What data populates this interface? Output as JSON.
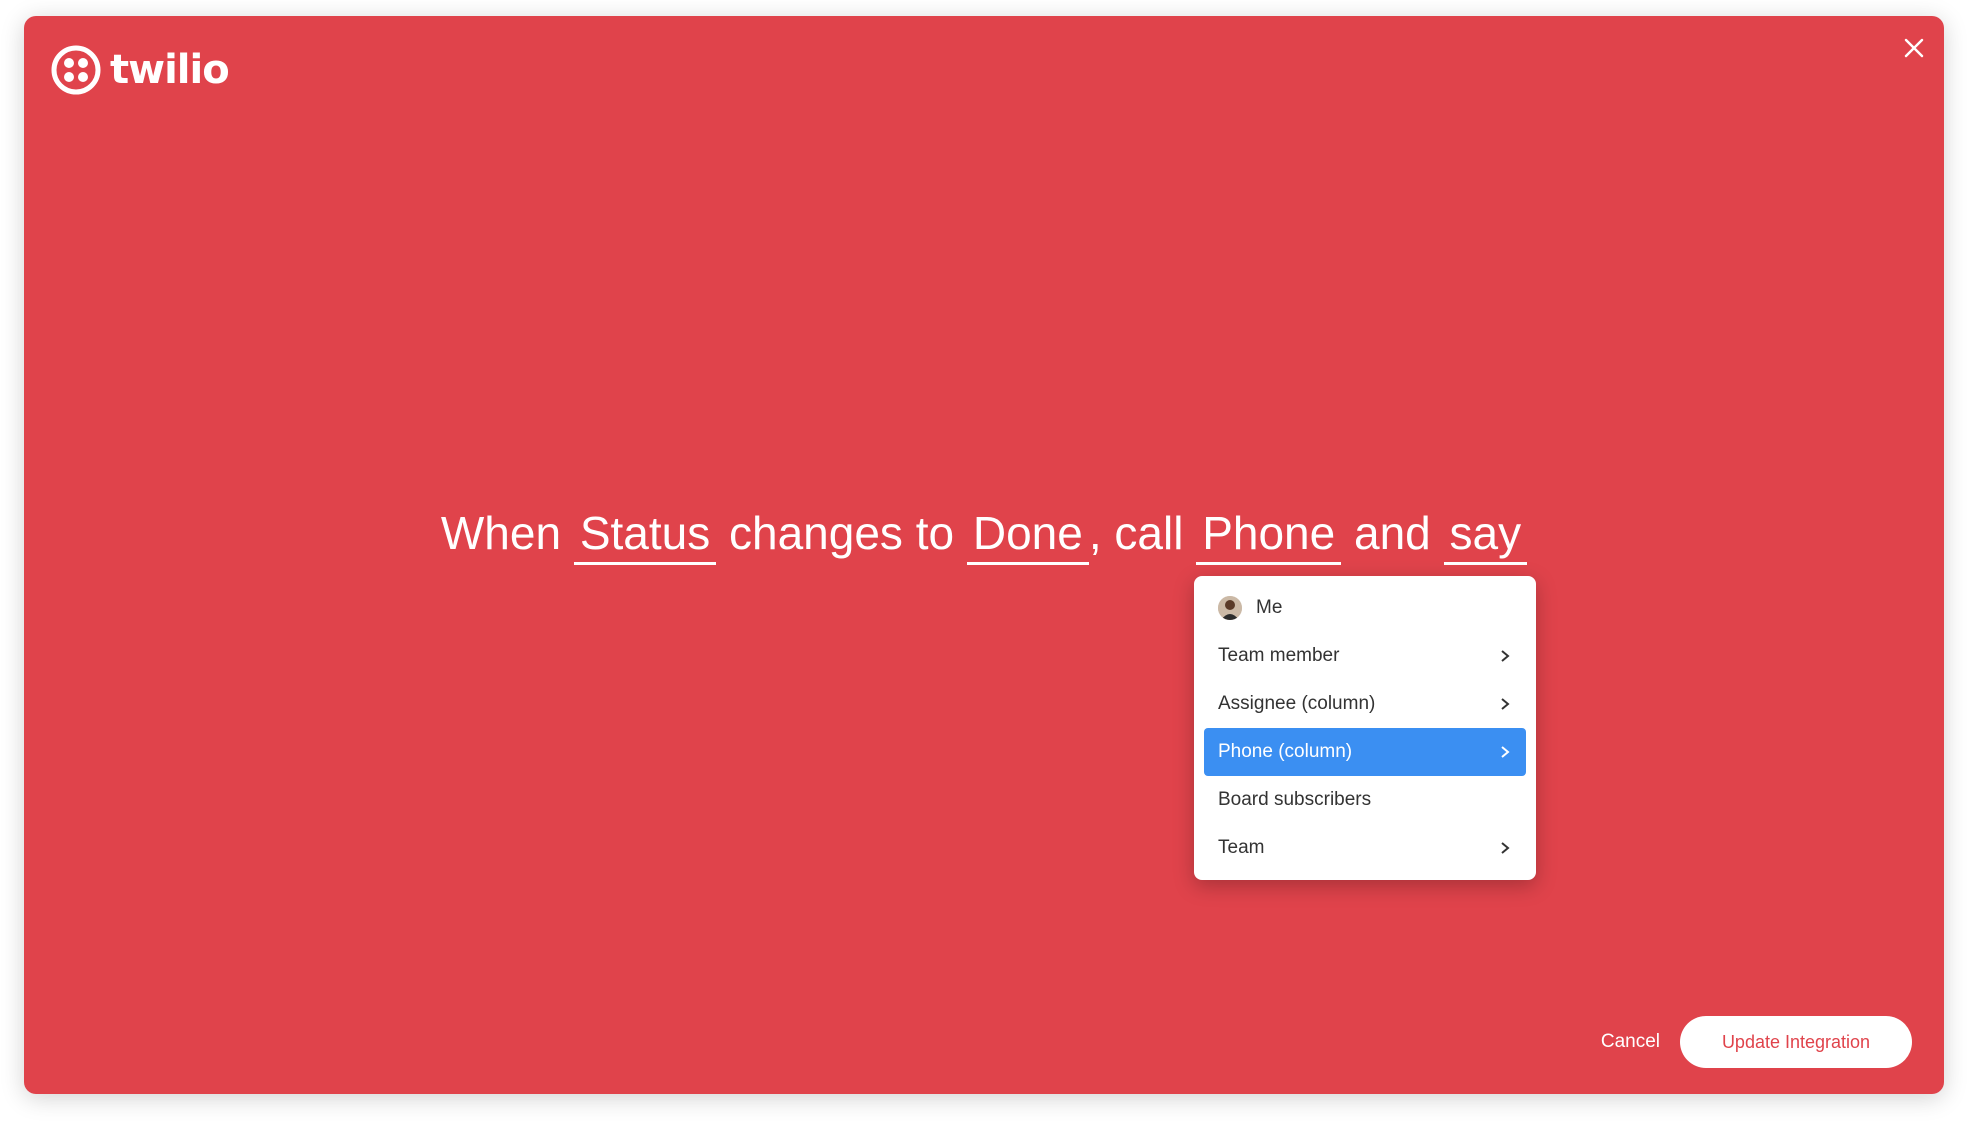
{
  "brand": {
    "name": "twilio",
    "color": "#e0434b"
  },
  "header": {
    "close_icon": "close-icon"
  },
  "sentence": {
    "part1": "When",
    "trigger_column": "Status",
    "part2": "changes to",
    "trigger_value": "Done",
    "part3": ", call",
    "call_target": "Phone",
    "part4": "and",
    "message": "say"
  },
  "dropdown": {
    "items": [
      {
        "label": "Me",
        "icon": "avatar",
        "has_submenu": false,
        "selected": false
      },
      {
        "label": "Team member",
        "has_submenu": true,
        "selected": false
      },
      {
        "label": "Assignee (column)",
        "has_submenu": true,
        "selected": false
      },
      {
        "label": "Phone (column)",
        "has_submenu": true,
        "selected": true
      },
      {
        "label": "Board subscribers",
        "has_submenu": false,
        "selected": false
      },
      {
        "label": "Team",
        "has_submenu": true,
        "selected": false
      }
    ],
    "selected_color": "#3b8ff2"
  },
  "footer": {
    "cancel_label": "Cancel",
    "update_label": "Update Integration"
  }
}
